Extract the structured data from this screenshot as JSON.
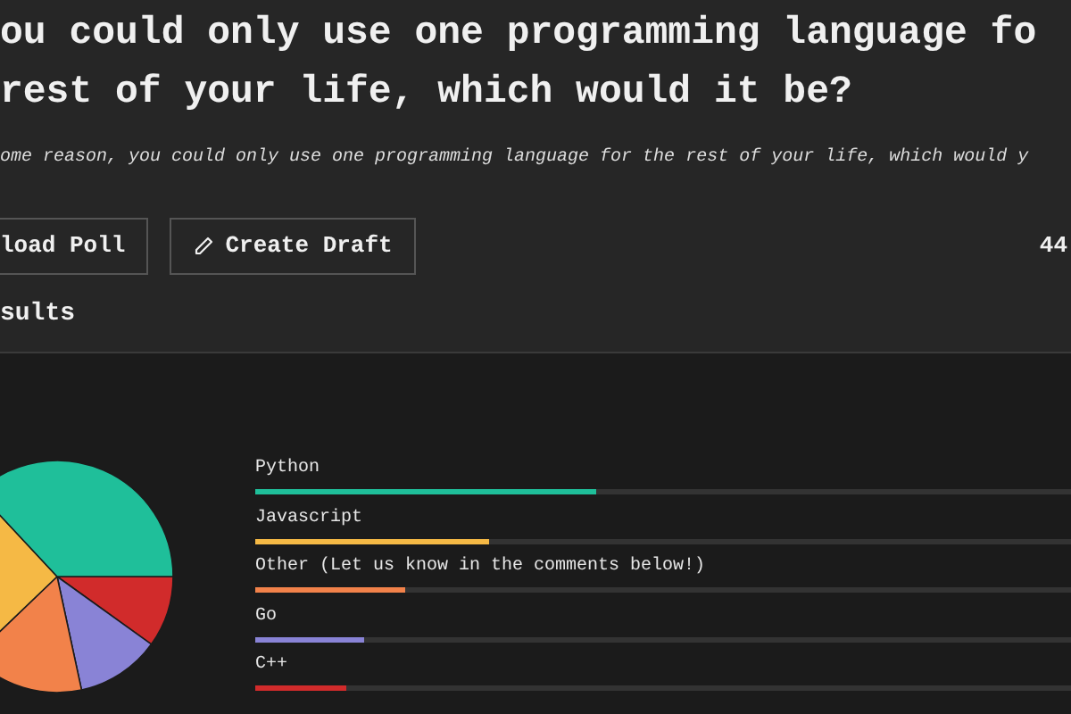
{
  "poll": {
    "title_lines": [
      "ou could only use one programming language fo",
      "rest of your life, which would it be?"
    ],
    "description": "ome reason, you could only use one programming language for the rest of your life, which would y",
    "buttons": [
      {
        "label": "load Poll",
        "kind": "plain"
      },
      {
        "label": "Create Draft",
        "kind": "pencil"
      }
    ],
    "count": "44"
  },
  "results": {
    "heading": "sults",
    "options": [
      {
        "label": "Python",
        "level": 0.41,
        "color": "#1fbf9a"
      },
      {
        "label": "Javascript",
        "level": 0.28,
        "color": "#f5b945"
      },
      {
        "label": "Other (Let us know in the comments below!)",
        "level": 0.18,
        "color": "#f2824a"
      },
      {
        "label": "Go",
        "level": 0.13,
        "color": "#8983d6"
      },
      {
        "label": "C++",
        "level": 0.11,
        "color": "#d12b2b"
      }
    ]
  }
}
